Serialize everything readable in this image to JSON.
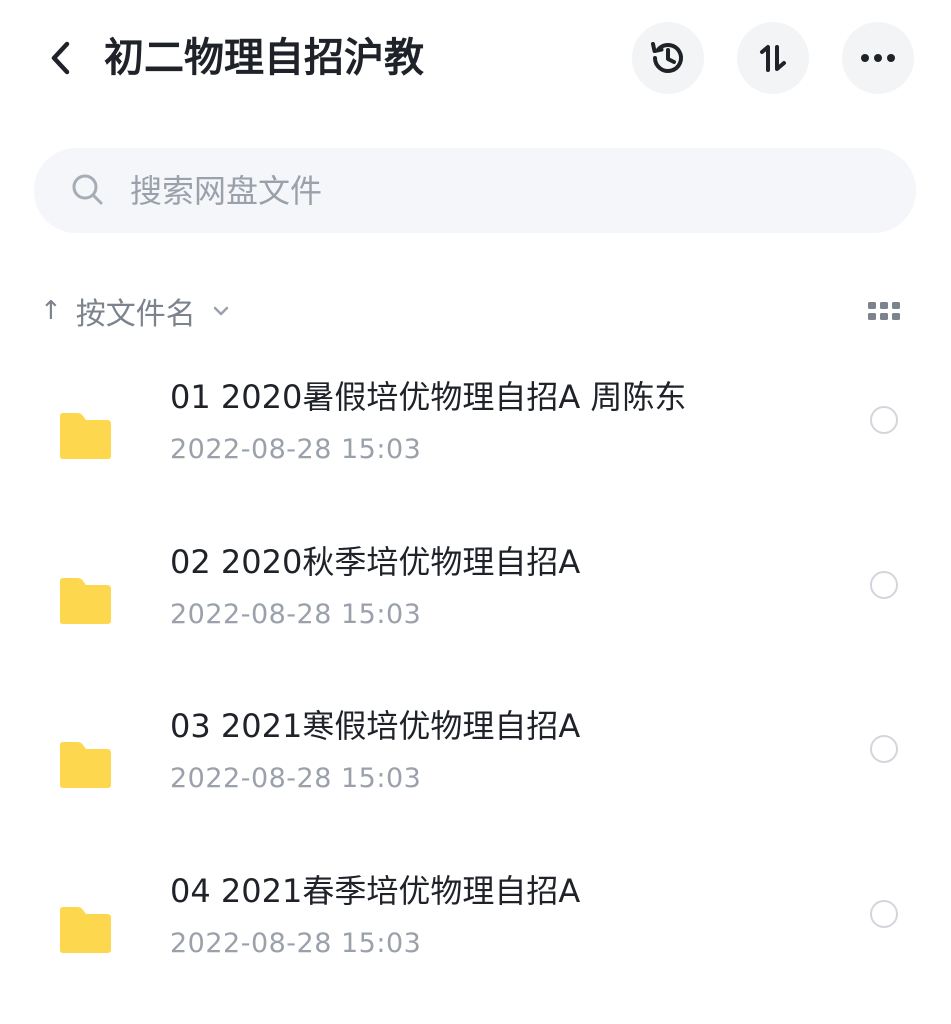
{
  "header": {
    "title": "初二物理自招沪教"
  },
  "search": {
    "placeholder": "搜索网盘文件"
  },
  "sort": {
    "arrow": "↑",
    "label": "按文件名"
  },
  "icons": {
    "back": "chevron-left-icon",
    "history": "history-icon",
    "sort": "sort-icon",
    "more": "more-icon",
    "search": "search-icon",
    "grid": "grid-view-icon",
    "folder": "folder-icon"
  },
  "colors": {
    "folder": "#fdd74d",
    "text_primary": "#1f2329",
    "text_secondary": "#9aa1ab",
    "button_bg": "#f3f4f6",
    "search_bg": "#f4f6f9"
  },
  "files": [
    {
      "name": "01 2020暑假培优物理自招A 周陈东",
      "date": "2022-08-28  15:03"
    },
    {
      "name": "02 2020秋季培优物理自招A",
      "date": "2022-08-28  15:03"
    },
    {
      "name": "03 2021寒假培优物理自招A",
      "date": "2022-08-28  15:03"
    },
    {
      "name": "04 2021春季培优物理自招A",
      "date": "2022-08-28  15:03"
    }
  ]
}
